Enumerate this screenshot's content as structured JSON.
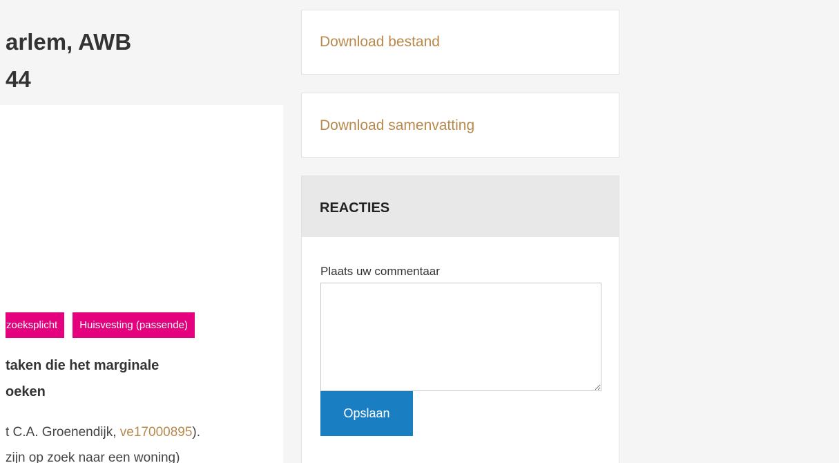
{
  "article": {
    "title": "arlem, AWB\n44",
    "tags": [
      "zoeksplicht",
      "Huisvesting (passende)"
    ],
    "summary_title": "taken die het marginale\noeken",
    "summary_text_prefix": "t C.A. Groenendijk, ",
    "summary_link": "ve17000895",
    "summary_text_suffix": ").",
    "summary_text_line2": "zijn op zoek naar een woning)"
  },
  "sidebar": {
    "download_file": "Download bestand",
    "download_summary": "Download samenvatting",
    "reacties": {
      "heading": "REACTIES",
      "comment_label": "Plaats uw commentaar",
      "comment_value": "",
      "save_label": "Opslaan"
    }
  },
  "colors": {
    "tag": "#e5007e",
    "link": "#b8894c",
    "button": "#1a7ec2"
  }
}
